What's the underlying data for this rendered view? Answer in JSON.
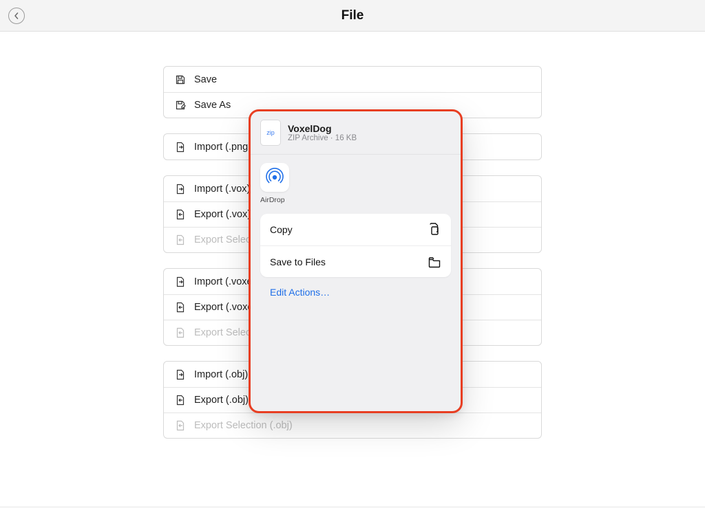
{
  "header": {
    "title": "File"
  },
  "groups": [
    {
      "rows": [
        {
          "icon": "save",
          "label": "Save",
          "disabled": false
        },
        {
          "icon": "saveas",
          "label": "Save As",
          "disabled": false
        }
      ]
    },
    {
      "rows": [
        {
          "icon": "import",
          "label": "Import (.png, .jpg)",
          "disabled": false
        }
      ]
    },
    {
      "rows": [
        {
          "icon": "import",
          "label": "Import (.vox)",
          "disabled": false
        },
        {
          "icon": "export",
          "label": "Export (.vox)",
          "disabled": false
        },
        {
          "icon": "export",
          "label": "Export Selection (.vox)",
          "disabled": true
        }
      ]
    },
    {
      "rows": [
        {
          "icon": "import",
          "label": "Import (.voxel)",
          "disabled": false
        },
        {
          "icon": "export",
          "label": "Export (.voxel)",
          "disabled": false
        },
        {
          "icon": "export",
          "label": "Export Selection (.voxel)",
          "disabled": true
        }
      ]
    },
    {
      "rows": [
        {
          "icon": "import",
          "label": "Import (.obj)",
          "disabled": false
        },
        {
          "icon": "export",
          "label": "Export (.obj)",
          "disabled": false
        },
        {
          "icon": "export",
          "label": "Export Selection (.obj)",
          "disabled": true
        }
      ]
    }
  ],
  "share": {
    "file": {
      "name": "VoxelDog",
      "type_label": "zip",
      "meta": "ZIP Archive · 16 KB"
    },
    "airdrop_label": "AirDrop",
    "actions": [
      {
        "label": "Copy",
        "icon": "copy"
      },
      {
        "label": "Save to Files",
        "icon": "folder"
      }
    ],
    "edit_label": "Edit Actions…"
  }
}
